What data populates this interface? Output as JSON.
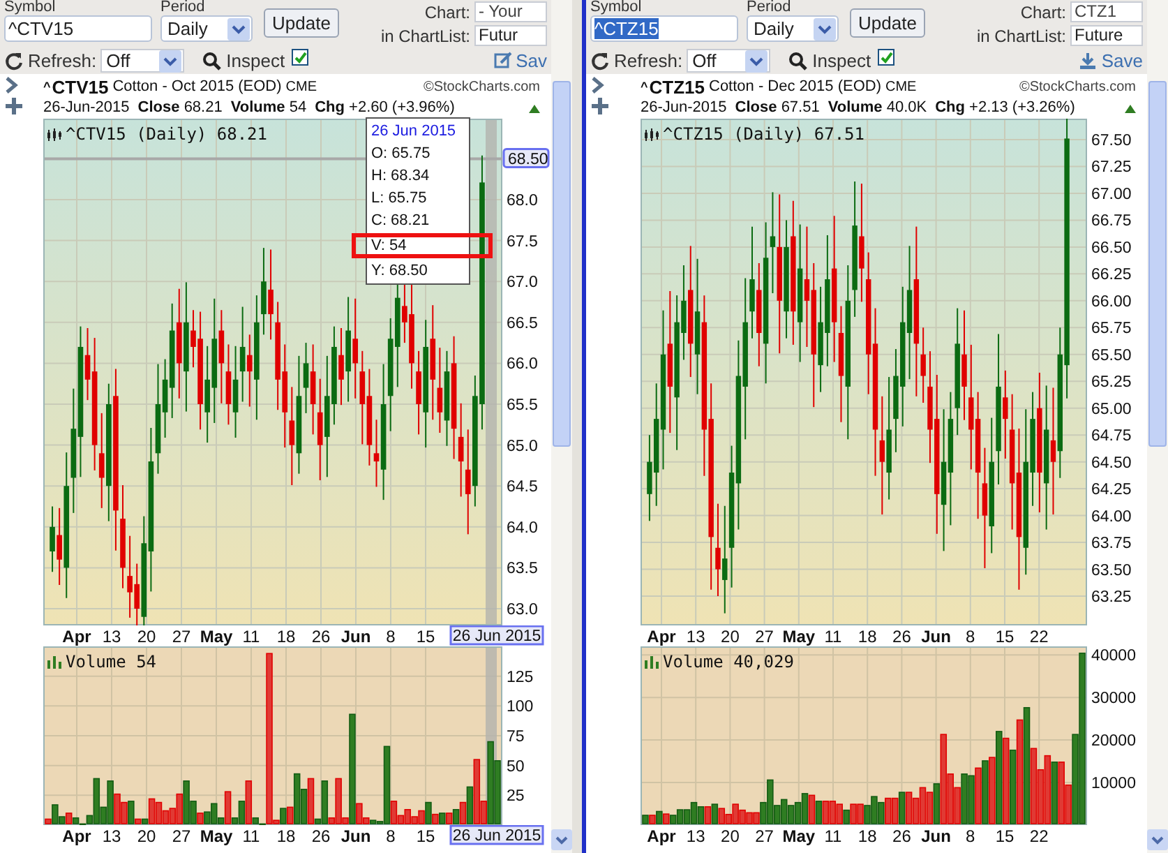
{
  "panes": [
    {
      "symbol_label": "Symbol",
      "symbol": "^CTV15",
      "symbol_selected": false,
      "period_label": "Period",
      "period": "Daily",
      "update": "Update",
      "chart_label": "Chart:",
      "chart_value": "- Your",
      "chartlist_label": "in ChartList:",
      "chartlist_value": "Futur",
      "refresh_label": "Refresh:",
      "refresh_value": "Off",
      "inspect_label": "Inspect",
      "inspect_checked": true,
      "save": "Sav",
      "chart": {
        "ticker_prefix": "^",
        "ticker": "CTV15",
        "name": "Cotton - Oct 2015 (EOD)",
        "exchange": "CME",
        "brand": "©StockCharts.com",
        "date": "26-Jun-2015",
        "stats": [
          {
            "label": "Close",
            "value": "68.21"
          },
          {
            "label": "Volume",
            "value": "54"
          },
          {
            "label": "Chg",
            "value": "+2.60 (+3.96%)"
          }
        ],
        "legend": "^CTV15 (Daily) 68.21",
        "price_axis": [
          "68.0",
          "67.5",
          "67.0",
          "66.5",
          "66.0",
          "65.5",
          "65.0",
          "64.5",
          "64.0",
          "63.5",
          "63.0"
        ],
        "price_tag": "68.50",
        "tooltip": {
          "title": "26 Jun 2015",
          "lines": [
            {
              "text": "O: 65.75",
              "highlighted": false
            },
            {
              "text": "H: 68.34",
              "highlighted": false
            },
            {
              "text": "L: 65.75",
              "highlighted": false
            },
            {
              "text": "C: 68.21",
              "highlighted": false
            },
            {
              "text": "V: 54",
              "highlighted": true
            },
            {
              "text": "Y: 68.50",
              "highlighted": false
            }
          ]
        },
        "price_xaxis": [
          {
            "label": "Apr",
            "kind": "month"
          },
          {
            "label": "13",
            "kind": "day"
          },
          {
            "label": "20",
            "kind": "day"
          },
          {
            "label": "27",
            "kind": "day"
          },
          {
            "label": "May",
            "kind": "month"
          },
          {
            "label": "11",
            "kind": "day"
          },
          {
            "label": "18",
            "kind": "day"
          },
          {
            "label": "26",
            "kind": "day"
          },
          {
            "label": "Jun",
            "kind": "month"
          },
          {
            "label": "8",
            "kind": "day"
          },
          {
            "label": "15",
            "kind": "day"
          }
        ],
        "price_date_tag": "26 Jun 2015",
        "volume_legend": "Volume 54",
        "chart_data": {
          "type": "bar",
          "stacked": true,
          "grid": true,
          "ylim": [
            0,
            150
          ],
          "yticks": [
            25,
            50,
            75,
            100,
            125
          ],
          "series": [
            {
              "color": "#2f7d22",
              "values": [
                null,
                17,
                7,
                null,
                6,
                1,
                8,
                39,
                15,
                37,
                null,
                null,
                20,
                null,
                5,
                null,
                null,
                null,
                null,
                null,
                37,
                20,
                null,
                11,
                18,
                6,
                null,
                6,
                20,
                null,
                6,
                1,
                null,
                null,
                14,
                null,
                43,
                30,
                null,
                5,
                37,
                null,
                null,
                null,
                93,
                null,
                null,
                4,
                3,
                66,
                null,
                null,
                null,
                null,
                null,
                19,
                null,
                10,
                null,
                13,
                null,
                32,
                null,
                null,
                70,
                54
              ]
            },
            {
              "color": "#e03a34",
              "values": [
                5,
                null,
                null,
                10,
                null,
                null,
                null,
                null,
                null,
                null,
                26,
                19,
                null,
                5,
                null,
                22,
                19,
                12,
                14,
                26,
                null,
                null,
                10,
                null,
                null,
                null,
                28,
                null,
                null,
                37,
                null,
                null,
                144,
                4,
                null,
                15,
                null,
                null,
                39,
                null,
                null,
                6,
                39,
                6,
                null,
                18,
                6,
                null,
                null,
                null,
                20,
                8,
                13,
                7,
                12,
                null,
                9,
                null,
                10,
                null,
                19,
                null,
                55,
                20,
                null,
                null
              ]
            }
          ]
        },
        "volume_xaxis": [
          {
            "label": "Apr",
            "kind": "month"
          },
          {
            "label": "13",
            "kind": "day"
          },
          {
            "label": "20",
            "kind": "day"
          },
          {
            "label": "27",
            "kind": "day"
          },
          {
            "label": "May",
            "kind": "month"
          },
          {
            "label": "11",
            "kind": "day"
          },
          {
            "label": "18",
            "kind": "day"
          },
          {
            "label": "26",
            "kind": "day"
          },
          {
            "label": "Jun",
            "kind": "month"
          },
          {
            "label": "8",
            "kind": "day"
          },
          {
            "label": "15",
            "kind": "day"
          }
        ],
        "volume_date_tag": "26 Jun 2015"
      }
    },
    {
      "symbol_label": "Symbol",
      "symbol": "^CTZ15",
      "symbol_selected": true,
      "period_label": "Period",
      "period": "Daily",
      "update": "Update",
      "chart_label": "Chart:",
      "chart_value": "CTZ1",
      "chartlist_label": "in ChartList:",
      "chartlist_value": "Future",
      "refresh_label": "Refresh:",
      "refresh_value": "Off",
      "inspect_label": "Inspect",
      "inspect_checked": true,
      "save": "Save",
      "chart": {
        "ticker_prefix": "^",
        "ticker": "CTZ15",
        "name": "Cotton - Dec 2015 (EOD)",
        "exchange": "CME",
        "brand": "©StockCharts.com",
        "date": "26-Jun-2015",
        "stats": [
          {
            "label": "Close",
            "value": "67.51"
          },
          {
            "label": "Volume",
            "value": "40.0K"
          },
          {
            "label": "Chg",
            "value": "+2.13 (+3.26%)"
          }
        ],
        "legend": "^CTZ15 (Daily) 67.51",
        "price_axis": [
          "67.50",
          "67.25",
          "67.00",
          "66.75",
          "66.50",
          "66.25",
          "66.00",
          "65.75",
          "65.50",
          "65.25",
          "65.00",
          "64.75",
          "64.50",
          "64.25",
          "64.00",
          "63.75",
          "63.50",
          "63.25"
        ],
        "price_xaxis": [
          {
            "label": "Apr",
            "kind": "month"
          },
          {
            "label": "13",
            "kind": "day"
          },
          {
            "label": "20",
            "kind": "day"
          },
          {
            "label": "27",
            "kind": "day"
          },
          {
            "label": "May",
            "kind": "month"
          },
          {
            "label": "11",
            "kind": "day"
          },
          {
            "label": "18",
            "kind": "day"
          },
          {
            "label": "26",
            "kind": "day"
          },
          {
            "label": "Jun",
            "kind": "month"
          },
          {
            "label": "8",
            "kind": "day"
          },
          {
            "label": "15",
            "kind": "day"
          },
          {
            "label": "22",
            "kind": "day"
          }
        ],
        "volume_legend": "Volume 40,029",
        "chart_data": {
          "type": "bar",
          "stacked": true,
          "grid": true,
          "ylim": [
            0,
            42000
          ],
          "yticks": [
            10000,
            20000,
            30000,
            40000
          ],
          "series": [
            {
              "color": "#2f7d22",
              "values": [
                2300,
                null,
                3200,
                null,
                2300,
                3600,
                3600,
                5300,
                4300,
                null,
                4900,
                null,
                null,
                null,
                null,
                null,
                null,
                5300,
                10600,
                4600,
                6000,
                4600,
                5300,
                7400,
                null,
                5600,
                null,
                null,
                null,
                3500,
                null,
                null,
                4600,
                6700,
                5300,
                null,
                null,
                7700,
                null,
                null,
                null,
                null,
                9700,
                null,
                null,
                null,
                12000,
                11600,
                null,
                15100,
                null,
                22000,
                null,
                17600,
                null,
                27600,
                null,
                null,
                null,
                14800,
                null,
                null,
                21300,
                40400
              ]
            },
            {
              "color": "#e03a34",
              "values": [
                null,
                2300,
                null,
                2600,
                null,
                null,
                null,
                null,
                null,
                4300,
                null,
                3900,
                2500,
                4900,
                3500,
                2900,
                2900,
                null,
                null,
                null,
                null,
                null,
                null,
                null,
                7000,
                null,
                5600,
                5600,
                4900,
                null,
                4900,
                4900,
                null,
                null,
                null,
                6300,
                6300,
                null,
                7700,
                6300,
                8800,
                7700,
                null,
                21300,
                12000,
                8800,
                null,
                null,
                13400,
                null,
                15900,
                null,
                20400,
                null,
                24700,
                null,
                18000,
                13000,
                16300,
                null,
                14800,
                9400,
                null,
                null
              ]
            }
          ]
        },
        "volume_xaxis": [
          {
            "label": "Apr",
            "kind": "month"
          },
          {
            "label": "13",
            "kind": "day"
          },
          {
            "label": "20",
            "kind": "day"
          },
          {
            "label": "27",
            "kind": "day"
          },
          {
            "label": "May",
            "kind": "month"
          },
          {
            "label": "11",
            "kind": "day"
          },
          {
            "label": "18",
            "kind": "day"
          },
          {
            "label": "26",
            "kind": "day"
          },
          {
            "label": "Jun",
            "kind": "month"
          },
          {
            "label": "8",
            "kind": "day"
          },
          {
            "label": "15",
            "kind": "day"
          },
          {
            "label": "22",
            "kind": "day"
          }
        ]
      }
    }
  ]
}
